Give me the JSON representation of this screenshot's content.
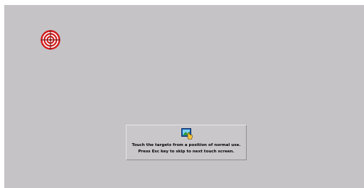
{
  "screen": {
    "background": "#c5c3c6"
  },
  "target": {
    "icon": "crosshair-target-icon",
    "color": "#d01818"
  },
  "info": {
    "icon": "touch-hand-icon",
    "line1": "Touch the targets from a position of normal use.",
    "line2": "Press Esc key to skip to next touch screen."
  }
}
